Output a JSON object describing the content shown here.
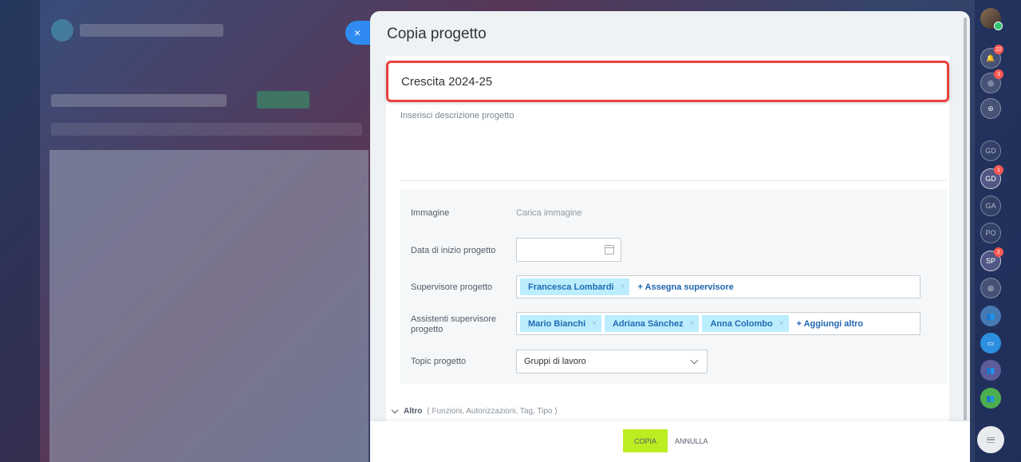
{
  "slider": {
    "title": "Copia progetto",
    "close_icon": "×"
  },
  "project": {
    "name": "Crescita 2024-25",
    "description_placeholder": "Inserisci descrizione progetto"
  },
  "form": {
    "image_label": "Immagine",
    "image_link": "Carica immagine",
    "start_date_label": "Data di inizio progetto",
    "start_date_value": "",
    "supervisor_label": "Supervisore progetto",
    "supervisors": [
      "Francesca Lombardi"
    ],
    "assign_supervisor": "+ Assegna supervisore",
    "assistants_label": "Assistenti supervisore progetto",
    "assistants": [
      "Mario Bianchi",
      "Adriana Sánchez",
      "Anna Colombo"
    ],
    "add_more": "+ Aggiungi altro",
    "topic_label": "Topic progetto",
    "topic_value": "Gruppi di lavoro",
    "tag_remove": "×"
  },
  "more": {
    "label": "Altro",
    "sub": "( Funzioni, Autorizzazioni, Tag, Tipo )"
  },
  "footer": {
    "copy_label": "COPIA",
    "cancel_label": "ANNULLA"
  },
  "rail": {
    "notifications_badge": "22",
    "activity_badge": "3",
    "avatars": [
      {
        "initials": "GD",
        "badge": ""
      },
      {
        "initials": "GD",
        "badge": "1"
      },
      {
        "initials": "GA",
        "badge": ""
      },
      {
        "initials": "PO",
        "badge": ""
      },
      {
        "initials": "SP",
        "badge": "2"
      }
    ]
  },
  "colors": {
    "accent": "#2f8bf2",
    "highlight": "#e8423c",
    "copy_button": "#bbed21",
    "tag_bg": "#bcedfc"
  }
}
